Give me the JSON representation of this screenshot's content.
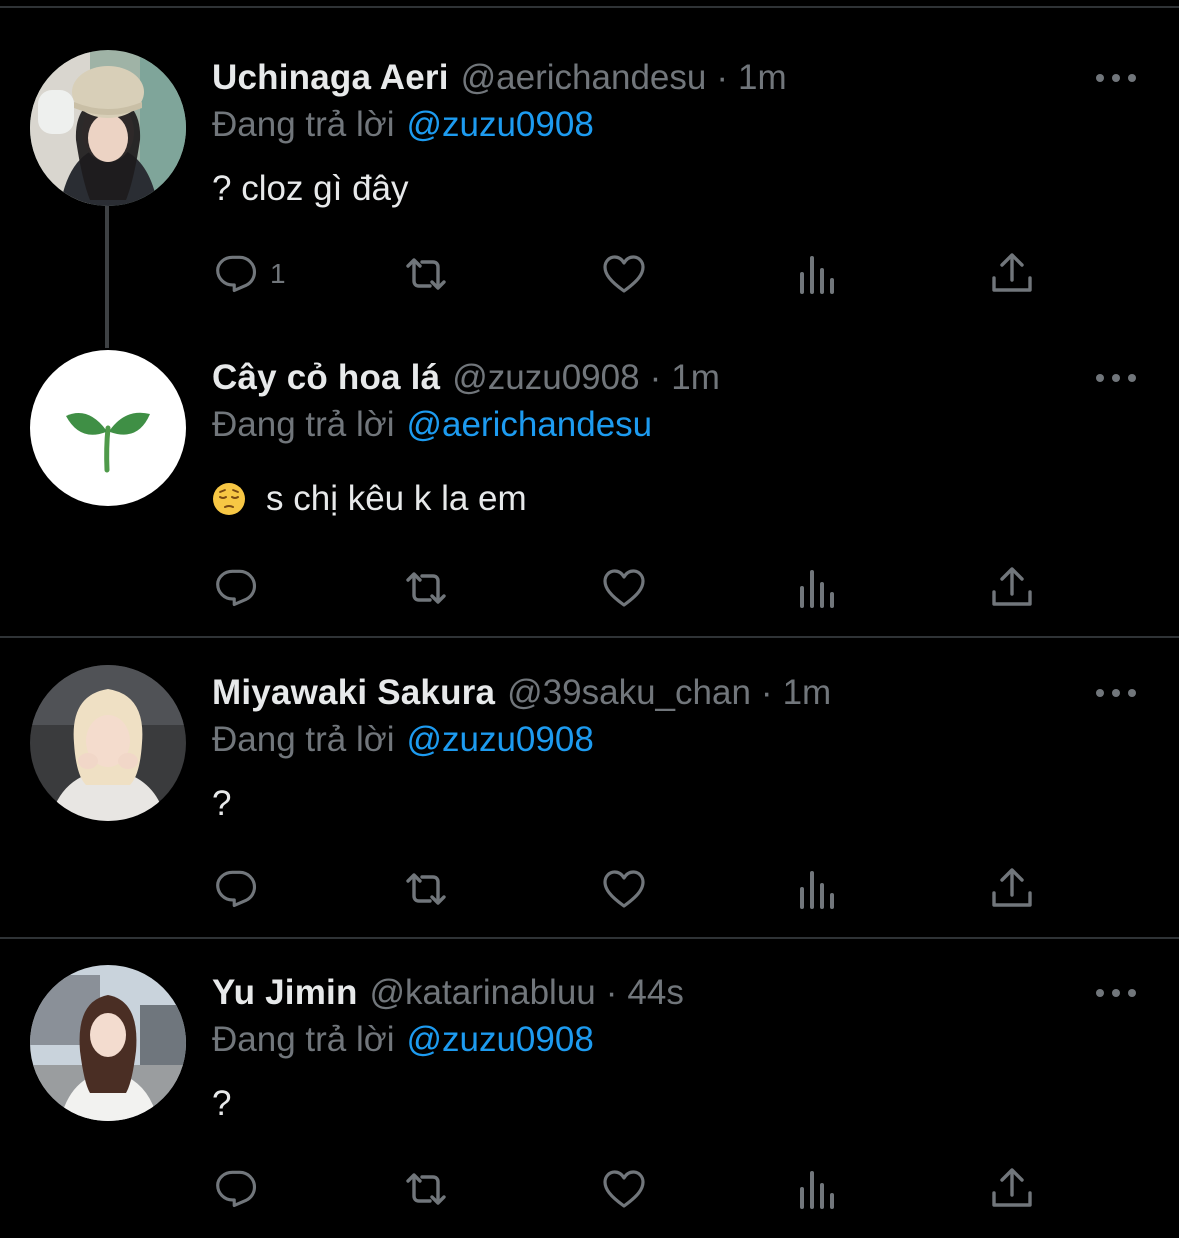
{
  "reply_prefix": "Đang trả lời",
  "tweets": [
    {
      "name": "Uchinaga Aeri",
      "handle": "@aerichandesu",
      "sep": "·",
      "time": "1m",
      "reply_to": "@zuzu0908",
      "text": "? cloz gì đây",
      "reply_count": "1"
    },
    {
      "name": "Cây cỏ hoa lá",
      "handle": "@zuzu0908",
      "sep": "·",
      "time": "1m",
      "reply_to": "@aerichandesu",
      "text": "s chị kêu k la em",
      "emoji": "pensive-face",
      "reply_count": ""
    },
    {
      "name": "Miyawaki Sakura",
      "handle": "@39saku_chan",
      "sep": "·",
      "time": "1m",
      "reply_to": "@zuzu0908",
      "text": "?",
      "reply_count": ""
    },
    {
      "name": "Yu Jimin",
      "handle": "@katarinabluu",
      "sep": "·",
      "time": "44s",
      "reply_to": "@zuzu0908",
      "text": "?",
      "reply_count": ""
    }
  ],
  "icons": {
    "reply": "reply-icon",
    "retweet": "retweet-icon",
    "like": "heart-icon",
    "views": "views-icon",
    "share": "share-icon",
    "more": "more-icon"
  },
  "colors": {
    "background": "#000000",
    "text": "#e7e9ea",
    "muted": "#71767b",
    "link": "#1d9bf0",
    "divider": "#2f3336"
  }
}
